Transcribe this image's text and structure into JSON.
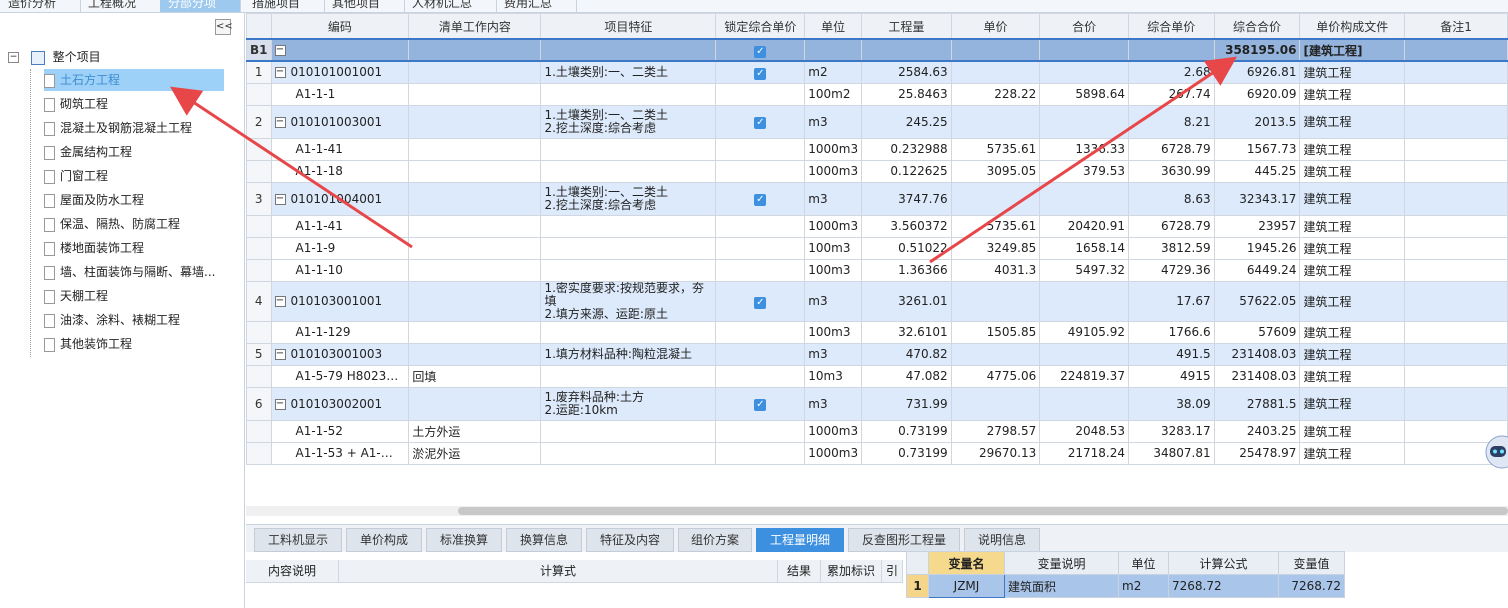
{
  "top_tabs": [
    {
      "label": "造价分析",
      "active": false
    },
    {
      "label": "工程概况",
      "active": false
    },
    {
      "label": "分部分项",
      "active": true
    },
    {
      "label": "措施项目",
      "active": false
    },
    {
      "label": "其他项目",
      "active": false
    },
    {
      "label": "人材机汇总",
      "active": false
    },
    {
      "label": "费用汇总",
      "active": false
    }
  ],
  "tree": {
    "collapse_label": "<<",
    "root": "整个项目",
    "items": [
      "土石方工程",
      "砌筑工程",
      "混凝土及钢筋混凝土工程",
      "金属结构工程",
      "门窗工程",
      "屋面及防水工程",
      "保温、隔热、防腐工程",
      "楼地面装饰工程",
      "墙、柱面装饰与隔断、幕墙...",
      "天棚工程",
      "油漆、涂料、裱糊工程",
      "其他装饰工程"
    ],
    "selected": "土石方工程"
  },
  "columns": [
    "编码",
    "清单工作内容",
    "项目特征",
    "锁定综合单价",
    "单位",
    "工程量",
    "单价",
    "合价",
    "综合单价",
    "综合合价",
    "单价构成文件",
    "备注1"
  ],
  "b1_row": {
    "idx": "B1",
    "total": "358195.06",
    "file": "[建筑工程]"
  },
  "rows": [
    {
      "type": "head",
      "idx": "1",
      "code": "010101001001",
      "feature1": "1.土壤类别:一、二类土",
      "feature2": "",
      "locked": true,
      "unit": "m2",
      "qty": "2584.63",
      "price": "",
      "total": "",
      "uprice": "2.68",
      "utotal": "6926.81",
      "file": "建筑工程"
    },
    {
      "type": "sub",
      "idx": "",
      "code": "A1-1-1",
      "content": "",
      "unit": "100m2",
      "qty": "25.8463",
      "price": "228.22",
      "total": "5898.64",
      "uprice": "267.74",
      "utotal": "6920.09",
      "file": "建筑工程"
    },
    {
      "type": "head",
      "idx": "2",
      "code": "010101003001",
      "feature1": "1.土壤类别:一、二类土",
      "feature2": "2.挖土深度:综合考虑",
      "locked": true,
      "unit": "m3",
      "qty": "245.25",
      "price": "",
      "total": "",
      "uprice": "8.21",
      "utotal": "2013.5",
      "file": "建筑工程"
    },
    {
      "type": "sub",
      "idx": "",
      "code": "A1-1-41",
      "content": "",
      "unit": "1000m3",
      "qty": "0.232988",
      "price": "5735.61",
      "total": "1336.33",
      "uprice": "6728.79",
      "utotal": "1567.73",
      "file": "建筑工程"
    },
    {
      "type": "sub",
      "idx": "",
      "code": "A1-1-18",
      "content": "",
      "unit": "1000m3",
      "qty": "0.122625",
      "price": "3095.05",
      "total": "379.53",
      "uprice": "3630.99",
      "utotal": "445.25",
      "file": "建筑工程"
    },
    {
      "type": "head",
      "idx": "3",
      "code": "010101004001",
      "feature1": "1.土壤类别:一、二类土",
      "feature2": "2.挖土深度:综合考虑",
      "locked": true,
      "unit": "m3",
      "qty": "3747.76",
      "price": "",
      "total": "",
      "uprice": "8.63",
      "utotal": "32343.17",
      "file": "建筑工程"
    },
    {
      "type": "sub",
      "idx": "",
      "code": "A1-1-41",
      "content": "",
      "unit": "1000m3",
      "qty": "3.560372",
      "price": "5735.61",
      "total": "20420.91",
      "uprice": "6728.79",
      "utotal": "23957",
      "file": "建筑工程"
    },
    {
      "type": "sub",
      "idx": "",
      "code": "A1-1-9",
      "content": "",
      "unit": "100m3",
      "qty": "0.51022",
      "price": "3249.85",
      "total": "1658.14",
      "uprice": "3812.59",
      "utotal": "1945.26",
      "file": "建筑工程"
    },
    {
      "type": "sub",
      "idx": "",
      "code": "A1-1-10",
      "content": "",
      "unit": "100m3",
      "qty": "1.36366",
      "price": "4031.3",
      "total": "5497.32",
      "uprice": "4729.36",
      "utotal": "6449.24",
      "file": "建筑工程"
    },
    {
      "type": "head",
      "idx": "4",
      "code": "010103001001",
      "feature1": "1.密实度要求:按规范要求，夯填",
      "feature2": "2.填方来源、运距:原土",
      "locked": true,
      "unit": "m3",
      "qty": "3261.01",
      "price": "",
      "total": "",
      "uprice": "17.67",
      "utotal": "57622.05",
      "file": "建筑工程"
    },
    {
      "type": "sub",
      "idx": "",
      "code": "A1-1-129",
      "content": "",
      "unit": "100m3",
      "qty": "32.6101",
      "price": "1505.85",
      "total": "49105.92",
      "uprice": "1766.6",
      "utotal": "57609",
      "file": "建筑工程"
    },
    {
      "type": "head",
      "idx": "5",
      "code": "010103001003",
      "feature1": "1.填方材料品种:陶粒混凝土",
      "feature2": "",
      "locked": false,
      "unit": "m3",
      "qty": "470.82",
      "price": "",
      "total": "",
      "uprice": "491.5",
      "utotal": "231408.03",
      "file": "建筑工程"
    },
    {
      "type": "sub",
      "idx": "",
      "code": "A1-5-79 H8023…",
      "content": "回填",
      "unit": "10m3",
      "qty": "47.082",
      "price": "4775.06",
      "total": "224819.37",
      "uprice": "4915",
      "utotal": "231408.03",
      "file": "建筑工程"
    },
    {
      "type": "head",
      "idx": "6",
      "code": "010103002001",
      "feature1": "1.废弃料品种:土方",
      "feature2": "2.运距:10km",
      "locked": true,
      "unit": "m3",
      "qty": "731.99",
      "price": "",
      "total": "",
      "uprice": "38.09",
      "utotal": "27881.5",
      "file": "建筑工程"
    },
    {
      "type": "sub",
      "idx": "",
      "code": "A1-1-52",
      "content": "土方外运",
      "unit": "1000m3",
      "qty": "0.73199",
      "price": "2798.57",
      "total": "2048.53",
      "uprice": "3283.17",
      "utotal": "2403.25",
      "file": "建筑工程"
    },
    {
      "type": "sub",
      "idx": "",
      "code": "A1-1-53 + A1-…",
      "content": "淤泥外运",
      "unit": "1000m3",
      "qty": "0.73199",
      "price": "29670.13",
      "total": "21718.24",
      "uprice": "34807.81",
      "utotal": "25478.97",
      "file": "建筑工程"
    }
  ],
  "bottom_tabs": [
    "工料机显示",
    "单价构成",
    "标准换算",
    "换算信息",
    "特征及内容",
    "组价方案",
    "工程量明细",
    "反查图形工程量",
    "说明信息"
  ],
  "bottom_active": "工程量明细",
  "detail_columns": [
    "内容说明",
    "计算式",
    "结果",
    "累加标识",
    "引"
  ],
  "vars_columns": [
    "变量名",
    "变量说明",
    "单位",
    "计算公式",
    "变量值"
  ],
  "vars_rows": [
    {
      "idx": "1",
      "name": "JZMJ",
      "desc": "建筑面积",
      "unit": "m2",
      "formula": "7268.72",
      "value": "7268.72"
    }
  ],
  "colors": {
    "accent": "#3d8fe0",
    "selected_row": "#94b4dd",
    "head_row": "#ddeafb",
    "arrow": "#e8474a"
  }
}
